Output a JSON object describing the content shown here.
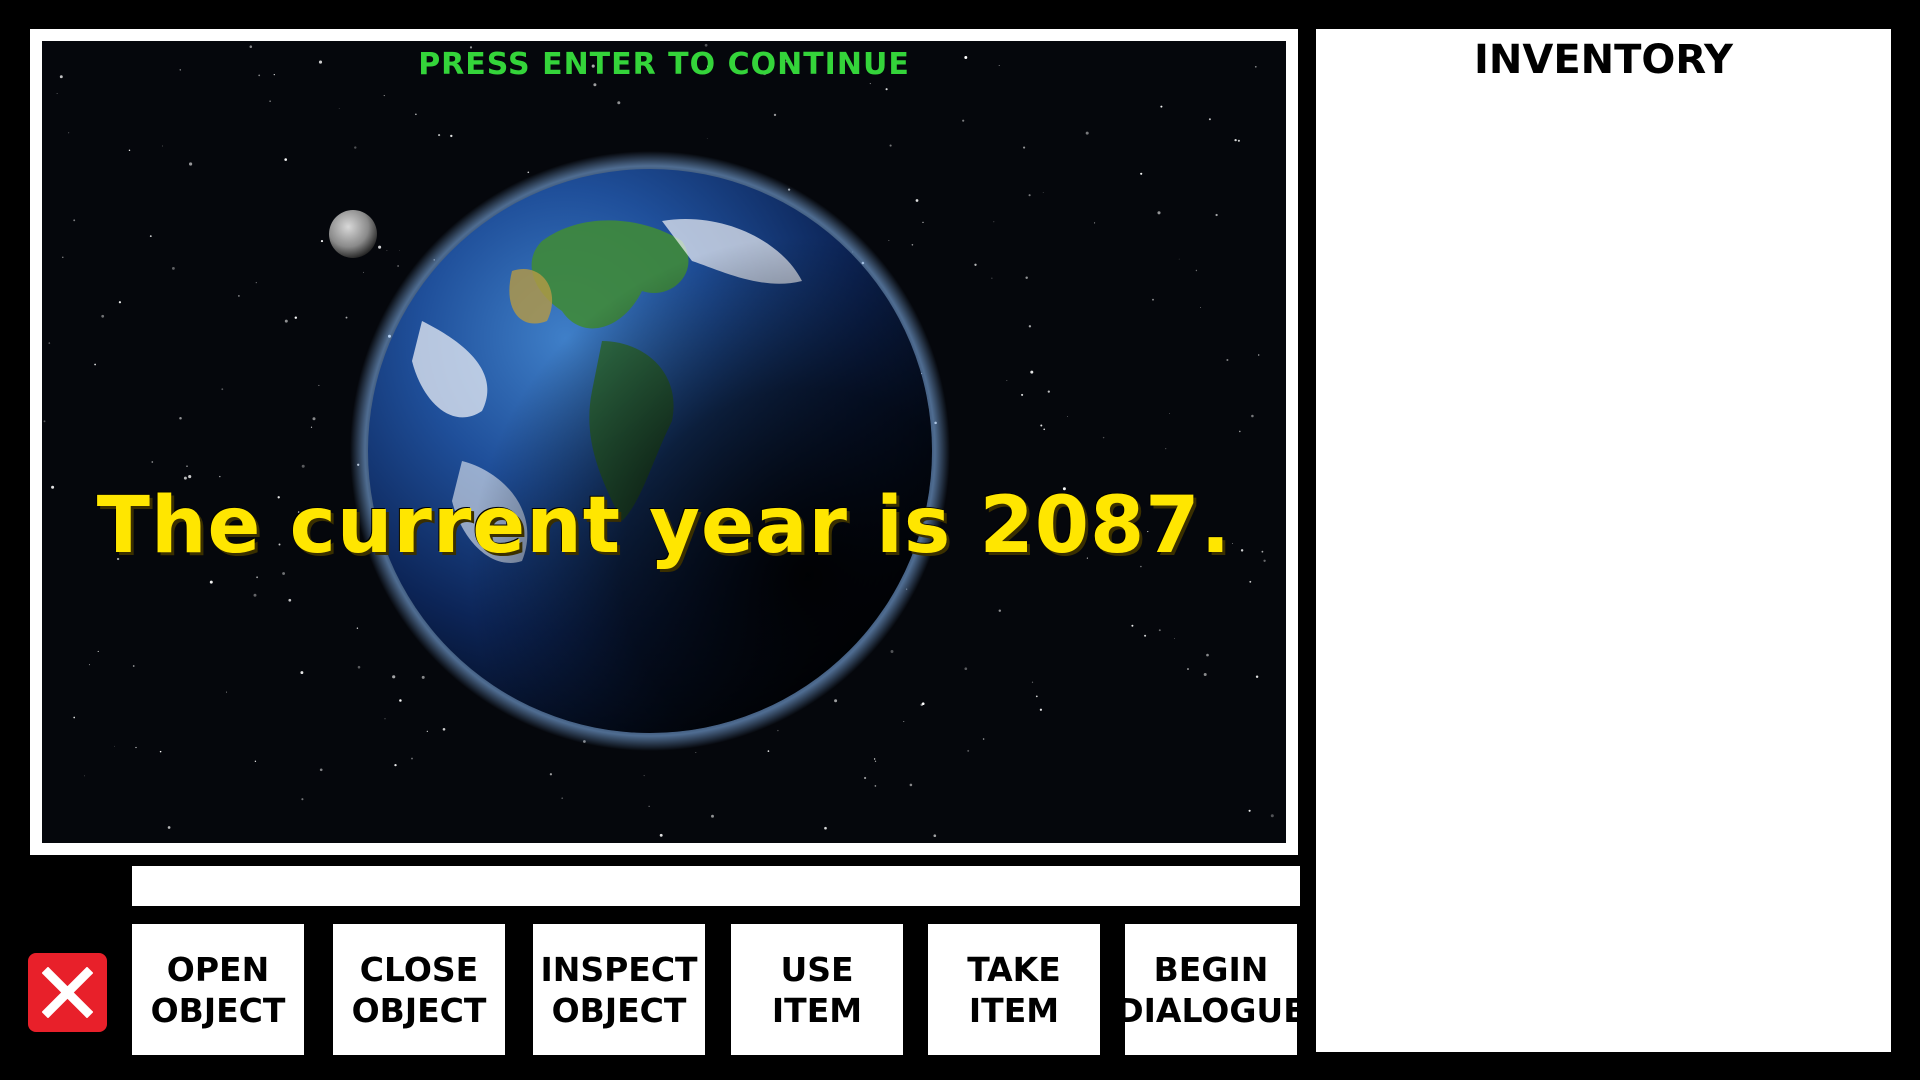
{
  "scene": {
    "prompt": "PRESS ENTER TO CONTINUE",
    "narration": "The current year is 2087.",
    "background": "earth-in-space",
    "prompt_color": "#34d43a",
    "narration_color": "#ffe600"
  },
  "command_input": {
    "value": "",
    "placeholder": ""
  },
  "controls": {
    "quit_icon": "close-icon",
    "quit_color": "#e8202a"
  },
  "actions": [
    {
      "line1": "OPEN",
      "line2": "OBJECT"
    },
    {
      "line1": "CLOSE",
      "line2": "OBJECT"
    },
    {
      "line1": "INSPECT",
      "line2": "OBJECT"
    },
    {
      "line1": "USE",
      "line2": "ITEM"
    },
    {
      "line1": "TAKE",
      "line2": "ITEM"
    },
    {
      "line1": "BEGIN",
      "line2": "DIALOGUE"
    }
  ],
  "inventory": {
    "title": "INVENTORY",
    "items": []
  }
}
